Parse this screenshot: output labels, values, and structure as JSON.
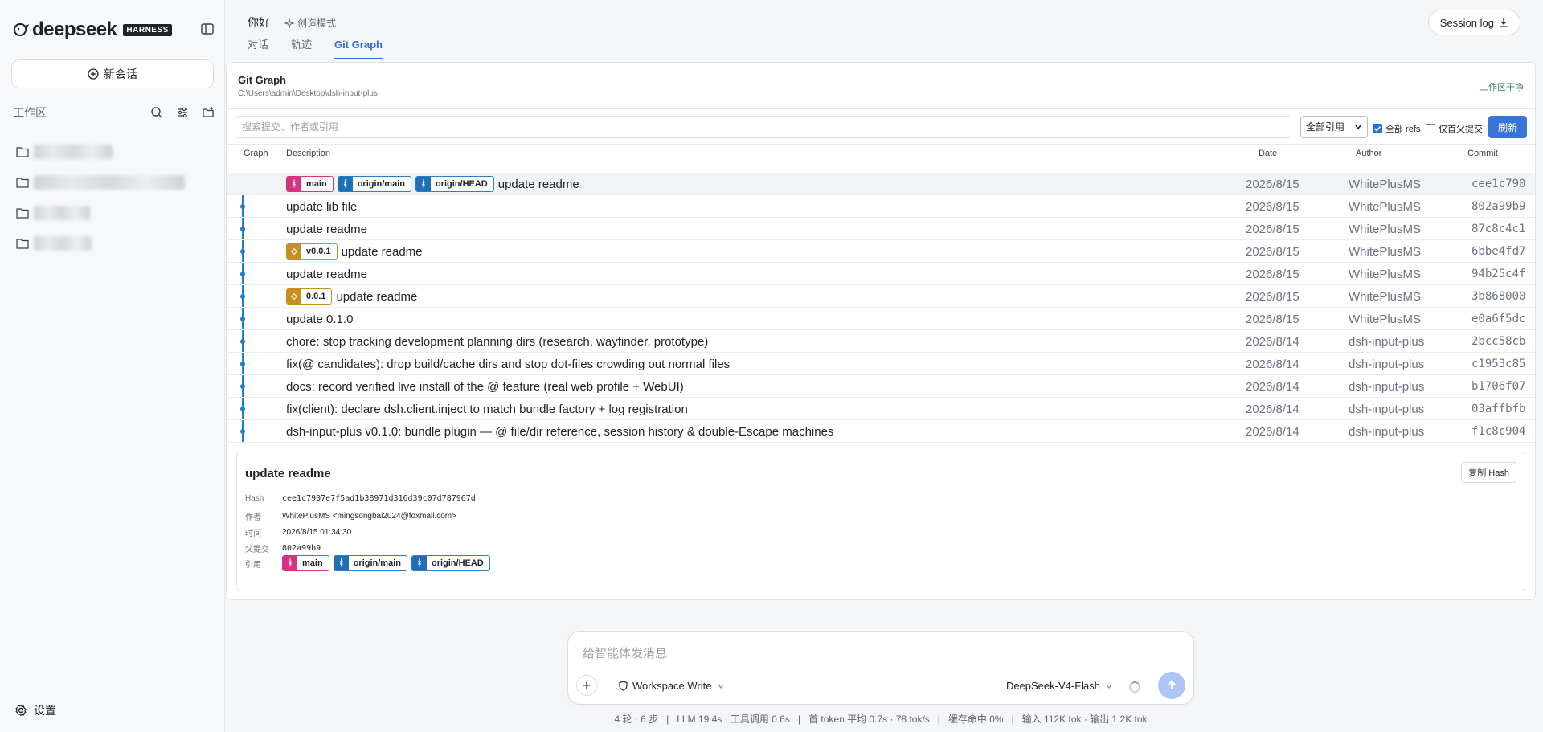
{
  "app": {
    "logo_text": "deepseek",
    "logo_badge": "HARNESS"
  },
  "sidebar": {
    "new_chat_label": "新会话",
    "workspace_title": "工作区",
    "settings_label": "设置"
  },
  "header": {
    "greeting": "你好",
    "mode_label": "创造模式",
    "tabs": [
      {
        "label": "对话"
      },
      {
        "label": "轨迹"
      },
      {
        "label": "Git Graph"
      }
    ],
    "session_log_label": "Session log"
  },
  "git": {
    "title": "Git Graph",
    "path": "C:\\Users\\admin\\Desktop\\dsh-input-plus",
    "status": "工作区干净",
    "search_placeholder": "搜索提交、作者或引用",
    "ref_filter": "全部引用",
    "all_refs_label": "全部 refs",
    "first_parent_label": "仅首父提交",
    "refresh_label": "刷新",
    "columns": {
      "graph": "Graph",
      "description": "Description",
      "date": "Date",
      "author": "Author",
      "commit": "Commit"
    },
    "commits": [
      {
        "refs": [
          {
            "type": "branch-local",
            "name": "main"
          },
          {
            "type": "branch-remote",
            "name": "origin/main"
          },
          {
            "type": "branch-remote",
            "name": "origin/HEAD"
          }
        ],
        "message": "update readme",
        "date": "2026/8/15",
        "author": "WhitePlusMS",
        "hash": "cee1c790",
        "selected": true
      },
      {
        "refs": [],
        "message": "update lib file",
        "date": "2026/8/15",
        "author": "WhitePlusMS",
        "hash": "802a99b9"
      },
      {
        "refs": [],
        "message": "update readme",
        "date": "2026/8/15",
        "author": "WhitePlusMS",
        "hash": "87c8c4c1"
      },
      {
        "refs": [
          {
            "type": "tag",
            "name": "v0.0.1"
          }
        ],
        "message": "update readme",
        "date": "2026/8/15",
        "author": "WhitePlusMS",
        "hash": "6bbe4fd7"
      },
      {
        "refs": [],
        "message": "update readme",
        "date": "2026/8/15",
        "author": "WhitePlusMS",
        "hash": "94b25c4f"
      },
      {
        "refs": [
          {
            "type": "tag",
            "name": "0.0.1"
          }
        ],
        "message": "update readme",
        "date": "2026/8/15",
        "author": "WhitePlusMS",
        "hash": "3b868000"
      },
      {
        "refs": [],
        "message": "update 0.1.0",
        "date": "2026/8/15",
        "author": "WhitePlusMS",
        "hash": "e0a6f5dc"
      },
      {
        "refs": [],
        "message": "chore: stop tracking development planning dirs (research, wayfinder, prototype)",
        "date": "2026/8/14",
        "author": "dsh-input-plus",
        "hash": "2bcc58cb"
      },
      {
        "refs": [],
        "message": "fix(@ candidates): drop build/cache dirs and stop dot-files crowding out normal files",
        "date": "2026/8/14",
        "author": "dsh-input-plus",
        "hash": "c1953c85"
      },
      {
        "refs": [],
        "message": "docs: record verified live install of the @ feature (real web profile + WebUI)",
        "date": "2026/8/14",
        "author": "dsh-input-plus",
        "hash": "b1706f07"
      },
      {
        "refs": [],
        "message": "fix(client): declare dsh.client.inject to match bundle factory + log registration",
        "date": "2026/8/14",
        "author": "dsh-input-plus",
        "hash": "03affbfb"
      },
      {
        "refs": [],
        "message": "dsh-input-plus v0.1.0: bundle plugin — @ file/dir reference, session history & double-Escape machines",
        "date": "2026/8/14",
        "author": "dsh-input-plus",
        "hash": "f1c8c904"
      }
    ],
    "detail": {
      "title": "update readme",
      "copy_hash_label": "复制 Hash",
      "hash_key": "Hash",
      "hash": "cee1c7907e7f5ad1b38971d316d39c07d787967d",
      "author_key": "作者",
      "author": "WhitePlusMS <mingsongbai2024@foxmail.com>",
      "time_key": "时间",
      "time": "2026/8/15 01:34:30",
      "parent_key": "父提交",
      "parent": "802a99b9",
      "refs_key": "引用",
      "refs": [
        "main",
        "origin/main",
        "origin/HEAD"
      ]
    }
  },
  "composer": {
    "placeholder": "给智能体发消息",
    "workspace_mode": "Workspace Write",
    "model": "DeepSeek-V4-Flash"
  },
  "statusbar": {
    "text": "4 轮 · 6 步   |   LLM 19.4s · 工具调用 0.6s   |   首 token 平均 0.7s · 78 tok/s   |   缓存命中 0%   |   输入 112K tok · 输出 1.2K tok"
  },
  "colors": {
    "accent": "#3b74d8",
    "graph_line": "#1e7ec8",
    "branch_local": "#d63384",
    "branch_remote": "#1e6fb8",
    "tag": "#c7901e",
    "clean_status": "#2e8b57"
  }
}
